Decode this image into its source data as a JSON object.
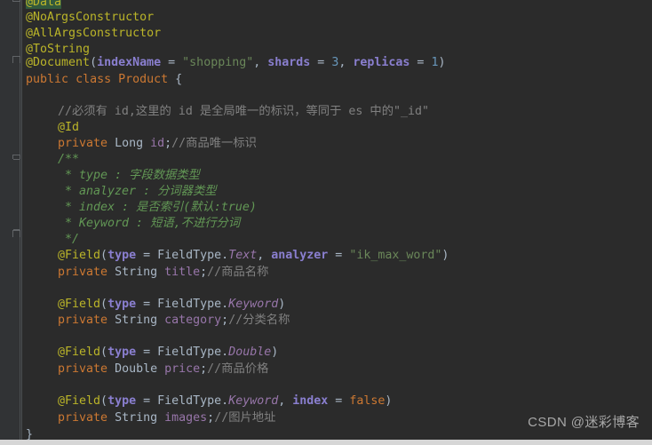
{
  "editor": {
    "theme_name": "darcula",
    "background": "#2b2b2b",
    "gutter_background": "#313335",
    "default_text_color": "#a9b7c6",
    "language": "java",
    "file_kind": "java-class"
  },
  "colors": {
    "annotation": "#bbb529",
    "keyword": "#cc7832",
    "string": "#6a8759",
    "number": "#6897bb",
    "field": "#9876aa",
    "parameter": "#9373a5",
    "comment": "#808080",
    "javadoc": "#629755",
    "search_highlight_bg": "#32593d"
  },
  "code_lines": [
    {
      "indent": 0,
      "text": "@Data",
      "kind": "annotation-highlighted"
    },
    {
      "indent": 0,
      "text": "@NoArgsConstructor",
      "kind": "annotation"
    },
    {
      "indent": 0,
      "text": "@AllArgsConstructor",
      "kind": "annotation"
    },
    {
      "indent": 0,
      "text": "@ToString",
      "kind": "annotation"
    },
    {
      "indent": 0,
      "text": "@Document(indexName = \"shopping\", shards = 3, replicas = 1)",
      "kind": "annotation-args"
    },
    {
      "indent": 0,
      "text": "public class Product {",
      "kind": "class-decl"
    },
    {
      "indent": 0,
      "text": "",
      "kind": "blank"
    },
    {
      "indent": 1,
      "text": "//必须有 id,这里的 id 是全局唯一的标识，等同于 es 中的\"_id\"",
      "kind": "comment"
    },
    {
      "indent": 1,
      "text": "@Id",
      "kind": "annotation"
    },
    {
      "indent": 1,
      "text": "private Long id;//商品唯一标识",
      "kind": "field-decl"
    },
    {
      "indent": 1,
      "text": "/**",
      "kind": "javadoc"
    },
    {
      "indent": 1,
      "text": " * type : 字段数据类型",
      "kind": "javadoc"
    },
    {
      "indent": 1,
      "text": " * analyzer : 分词器类型",
      "kind": "javadoc"
    },
    {
      "indent": 1,
      "text": " * index : 是否索引(默认:true)",
      "kind": "javadoc"
    },
    {
      "indent": 1,
      "text": " * Keyword : 短语,不进行分词",
      "kind": "javadoc"
    },
    {
      "indent": 1,
      "text": " */",
      "kind": "javadoc"
    },
    {
      "indent": 1,
      "text": "@Field(type = FieldType.Text, analyzer = \"ik_max_word\")",
      "kind": "annotation-args"
    },
    {
      "indent": 1,
      "text": "private String title;//商品名称",
      "kind": "field-decl"
    },
    {
      "indent": 1,
      "text": "",
      "kind": "blank"
    },
    {
      "indent": 1,
      "text": "@Field(type = FieldType.Keyword)",
      "kind": "annotation-args"
    },
    {
      "indent": 1,
      "text": "private String category;//分类名称",
      "kind": "field-decl"
    },
    {
      "indent": 1,
      "text": "",
      "kind": "blank"
    },
    {
      "indent": 1,
      "text": "@Field(type = FieldType.Double)",
      "kind": "annotation-args"
    },
    {
      "indent": 1,
      "text": "private Double price;//商品价格",
      "kind": "field-decl"
    },
    {
      "indent": 1,
      "text": "",
      "kind": "blank"
    },
    {
      "indent": 1,
      "text": "@Field(type = FieldType.Keyword, index = false)",
      "kind": "annotation-args"
    },
    {
      "indent": 1,
      "text": "private String images;//图片地址",
      "kind": "field-decl"
    },
    {
      "indent": 0,
      "text": "}",
      "kind": "brace"
    }
  ],
  "tokens": {
    "l0_annotation": "@Data",
    "l1_annotation": "@NoArgsConstructor",
    "l2_annotation": "@AllArgsConstructor",
    "l3_annotation": "@ToString",
    "l4_annotation": "@Document",
    "l4_open": "(",
    "l4_param1": "indexName",
    "l4_eq1": " = ",
    "l4_string1": "\"shopping\"",
    "l4_comma1": ", ",
    "l4_param2": "shards",
    "l4_eq2": " = ",
    "l4_num1": "3",
    "l4_comma2": ", ",
    "l4_param3": "replicas",
    "l4_eq3": " = ",
    "l4_num2": "1",
    "l4_close": ")",
    "l5_kw1": "public",
    "l5_kw2": "class",
    "l5_name": "Product",
    "l5_brace": "{",
    "l7_comment": "//必须有 id,这里的 id 是全局唯一的标识，等同于 es 中的\"_id\"",
    "l8_annotation": "@Id",
    "l9_kw": "private",
    "l9_type": "Long",
    "l9_field": "id",
    "l9_semi": ";",
    "l9_comment": "//商品唯一标识",
    "l10_doc": "/**",
    "l11_doc": " * type : 字段数据类型",
    "l12_doc": " * analyzer : 分词器类型",
    "l13_doc": " * index : 是否索引(默认:true)",
    "l14_doc": " * Keyword : 短语,不进行分词",
    "l15_doc": " */",
    "l16_annotation": "@Field",
    "l16_open": "(",
    "l16_param1": "type",
    "l16_eq1": " = ",
    "l16_enumtype": "FieldType.",
    "l16_enumval": "Text",
    "l16_comma": ", ",
    "l16_param2": "analyzer",
    "l16_eq2": " = ",
    "l16_string": "\"ik_max_word\"",
    "l16_close": ")",
    "l17_kw": "private",
    "l17_type": "String",
    "l17_field": "title",
    "l17_semi": ";",
    "l17_comment": "//商品名称",
    "l19_annotation": "@Field",
    "l19_open": "(",
    "l19_param1": "type",
    "l19_eq1": " = ",
    "l19_enumtype": "FieldType.",
    "l19_enumval": "Keyword",
    "l19_close": ")",
    "l20_kw": "private",
    "l20_type": "String",
    "l20_field": "category",
    "l20_semi": ";",
    "l20_comment": "//分类名称",
    "l22_annotation": "@Field",
    "l22_open": "(",
    "l22_param1": "type",
    "l22_eq1": " = ",
    "l22_enumtype": "FieldType.",
    "l22_enumval": "Double",
    "l22_close": ")",
    "l23_kw": "private",
    "l23_type": "Double",
    "l23_field": "price",
    "l23_semi": ";",
    "l23_comment": "//商品价格",
    "l25_annotation": "@Field",
    "l25_open": "(",
    "l25_param1": "type",
    "l25_eq1": " = ",
    "l25_enumtype": "FieldType.",
    "l25_enumval": "Keyword",
    "l25_comma": ", ",
    "l25_param2": "index",
    "l25_eq2": " = ",
    "l25_kwfalse": "false",
    "l25_close": ")",
    "l26_kw": "private",
    "l26_type": "String",
    "l26_field": "images",
    "l26_semi": ";",
    "l26_comment": "//图片地址",
    "l27_brace": "}"
  },
  "gutter": {
    "fold_markers": [
      {
        "line_index": 0,
        "state": "expanded"
      },
      {
        "line_index": 4,
        "state": "collapsed-top"
      },
      {
        "line_index": 10,
        "state": "expanded"
      },
      {
        "line_index": 15,
        "state": "collapsed-bottom"
      }
    ]
  },
  "watermark": {
    "text": "CSDN @迷彩博客"
  }
}
